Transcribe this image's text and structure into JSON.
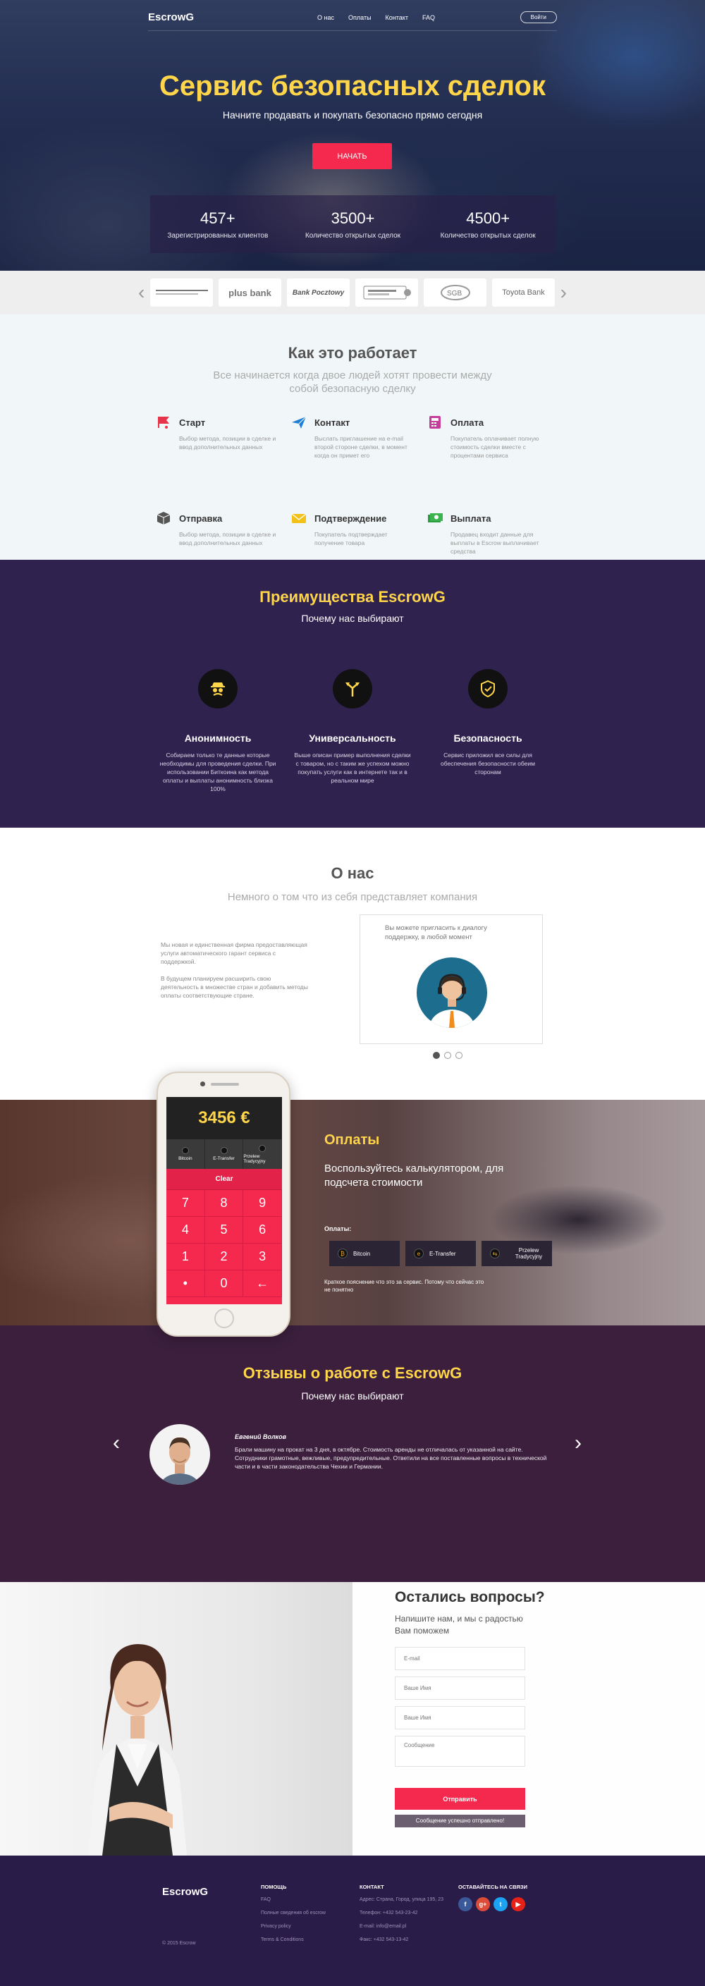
{
  "nav": {
    "logo": "EscrowG",
    "menu": [
      "О нас",
      "Оплаты",
      "Контакт",
      "FAQ"
    ],
    "login": "Войти"
  },
  "hero": {
    "title": "Сервис безопасных сделок",
    "subtitle": "Начните продавать и покупать безопасно прямо сегодня",
    "cta": "НАЧАТЬ",
    "stats": [
      {
        "num": "457+",
        "label": "Зарегистрированных клиентов"
      },
      {
        "num": "3500+",
        "label": "Количество открытых сделок"
      },
      {
        "num": "4500+",
        "label": "Количество открытых сделок"
      }
    ]
  },
  "partners": [
    "",
    "plus bank",
    "Bank Pocztowy",
    "",
    "SGB",
    "Toyota Bank"
  ],
  "how": {
    "title": "Как это работает",
    "subtitle": "Все начинается когда двое людей хотят провести между собой безопасную сделку",
    "steps": [
      {
        "title": "Старт",
        "desc": "Выбор метода, позиции в сделке и ввод дополнительных данных",
        "icon": "flag-icon",
        "color": "#e6344b"
      },
      {
        "title": "Контакт",
        "desc": "Выслать приглашение на e-mail второй стороне сделки, в момент когда он примет его",
        "icon": "paper-plane-icon",
        "color": "#1d7fd8"
      },
      {
        "title": "Оплата",
        "desc": "Покупатель оплачивает полную стоимость сделки вместе с процентами сервиса",
        "icon": "pay-terminal-icon",
        "color": "#c43d9a"
      },
      {
        "title": "Отправка",
        "desc": "Выбор метода, позиции в сделке и ввод дополнительных данных",
        "icon": "box-icon",
        "color": "#444444"
      },
      {
        "title": "Подтверждение",
        "desc": "Покупатель подтверждает получение товара",
        "icon": "envelope-icon",
        "color": "#f2c21b"
      },
      {
        "title": "Выплата",
        "desc": "Продавец входит данные для выплаты в Escrow выплачивает средства",
        "icon": "money-icon",
        "color": "#2c9a3f"
      }
    ]
  },
  "advantages": {
    "title": "Преимущества EscrowG",
    "subtitle": "Почему нас выбирают",
    "items": [
      {
        "title": "Анонимность",
        "desc": "Собираем только те данные которые необходимы для проведения сделки. При использовании Биткоина как метода оплаты и выплаты анонимность близка 100%",
        "icon": "spy-icon"
      },
      {
        "title": "Универсальность",
        "desc": "Выше описан пример выполнения сделки с товаром, но с таким же успехом можно покупать услуги как в интернете так и в реальном мире",
        "icon": "split-arrows-icon"
      },
      {
        "title": "Безопасность",
        "desc": "Сервис приложил все силы для обеспечения безопасности обеим сторонам",
        "icon": "shield-check-icon"
      }
    ]
  },
  "about": {
    "title": "О нас",
    "subtitle": "Немного о том что из себя представляет компания",
    "paragraphs": [
      "Мы новая и единственная фирма предоставляющая услуги автоматического гарант сервиса с поддержкой.",
      "В будущем планируем расширить свою деятельность в множестве стран и добавить методы оплаты соответствующие стране."
    ],
    "card_text": "Вы можете пригласить к диалогу поддержку, в любой момент"
  },
  "payments": {
    "title": "Оплаты",
    "subtitle": "Воспользуйтесь калькулятором, для подсчета стоимости",
    "label": "Оплаты:",
    "options": [
      "Bitcoin",
      "E-Transfer",
      "Przelew Tradycyjny"
    ],
    "note": "Краткое пояснение что это за сервис. Потому что сейчас это не понятно",
    "phone": {
      "amount": "3456 €",
      "methods": [
        "Bitcoin",
        "E-Transfer",
        "Przelew Tradycyjny"
      ],
      "clear": "Clear",
      "keys": [
        "7",
        "8",
        "9",
        "4",
        "5",
        "6",
        "1",
        "2",
        "3",
        "•",
        "0",
        "←"
      ]
    }
  },
  "reviews": {
    "title": "Отзывы о работе с EscrowG",
    "subtitle": "Почему нас выбирают",
    "name": "Евгений Волков",
    "text": "Брали машину на прокат на 3 дня, в октябре. Стоимость аренды не отличалась от указанной на сайте. Сотрудники грамотные, вежливые, предупредительные. Ответили на все поставленные вопросы в технической части и в части законодательства Чехии и Германии."
  },
  "contact": {
    "title": "Остались вопросы?",
    "subtitle": "Напишите нам, и мы с радостью Вам поможем",
    "placeholders": {
      "email": "E-mail",
      "name": "Ваше Имя",
      "surname": "Ваше Имя",
      "message": "Сообщение"
    },
    "button": "Отправить",
    "success": "Сообщение успешно отправлено!"
  },
  "footer": {
    "logo": "EscrowG",
    "copyright": "© 2015 Escrow",
    "help_head": "ПОМОЩЬ",
    "help_links": [
      "FAQ",
      "Полные сведения об escrow",
      "Privacy policy",
      "Terms & Conditions"
    ],
    "contact_head": "КОНТАКТ",
    "contact_lines": [
      "Адрес: Страна, Город, улица 195, 23",
      "Телефон: +432 543-23-42",
      "E-mail: info@email.pl",
      "Факс: +432 543-13-42"
    ],
    "social_head": "ОСТАВАЙТЕСЬ НА СВЯЗИ",
    "socials": [
      {
        "letter": "f",
        "color": "#3b5998"
      },
      {
        "letter": "g+",
        "color": "#dd4b39"
      },
      {
        "letter": "t",
        "color": "#1da1f2"
      },
      {
        "letter": "▶",
        "color": "#e62117"
      }
    ]
  }
}
